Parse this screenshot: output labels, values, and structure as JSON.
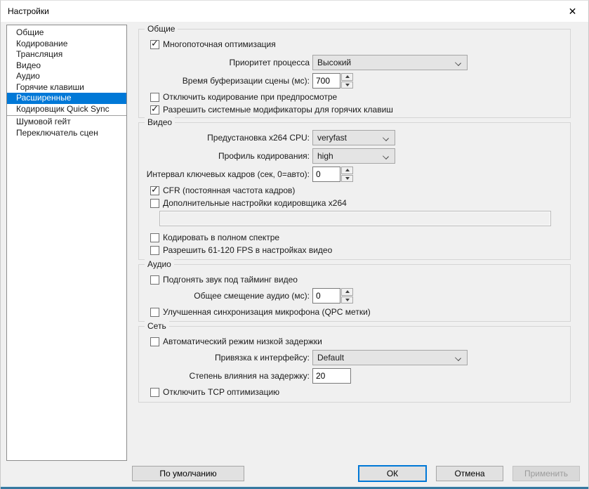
{
  "window": {
    "title": "Настройки"
  },
  "icons": {
    "close": "✕",
    "check": "✓"
  },
  "sidebar": {
    "items": [
      "Общие",
      "Кодирование",
      "Трансляция",
      "Видео",
      "Аудио",
      "Горячие клавиши",
      "Расширенные",
      "Кодировщик Quick Sync",
      "Шумовой гейт",
      "Переключатель сцен"
    ],
    "selected": "Расширенные"
  },
  "groups": {
    "general": {
      "title": "Общие",
      "multithread_checkbox": "Многопоточная оптимизация",
      "priority_label": "Приоритет процесса",
      "priority_value": "Высокий",
      "buffer_label": "Время буферизации сцены (мс):",
      "buffer_value": "700",
      "disable_preview_encoding_checkbox": "Отключить кодирование при предпросмотре",
      "allow_modifiers_checkbox": "Разрешить системные модификаторы для горячих клавиш"
    },
    "video": {
      "title": "Видео",
      "preset_label": "Предустановка x264 CPU:",
      "preset_value": "veryfast",
      "profile_label": "Профиль кодирования:",
      "profile_value": "high",
      "keyframe_label": "Интервал ключевых кадров (сек, 0=авто):",
      "keyframe_value": "0",
      "cfr_checkbox": "CFR (постоянная частота кадров)",
      "custom_x264_checkbox": "Дополнительные настройки кодировщика x264",
      "custom_x264_value": "",
      "full_range_checkbox": "Кодировать в полном спектре",
      "allow_fps_checkbox": "Разрешить 61-120 FPS в настройках видео"
    },
    "audio": {
      "title": "Аудио",
      "sync_checkbox": "Подгонять звук под тайминг видео",
      "offset_label": "Общее смещение аудио (мс):",
      "offset_value": "0",
      "mic_qpc_checkbox": "Улучшенная синхронизация микрофона (QPC метки)"
    },
    "network": {
      "title": "Сеть",
      "low_latency_checkbox": "Автоматический режим низкой задержки",
      "binding_label": "Привязка к интерфейсу:",
      "binding_value": "Default",
      "latency_factor_label": "Степень влияния на задержку:",
      "latency_factor_value": "20",
      "tcp_checkbox": "Отключить TCP оптимизацию"
    }
  },
  "footer": {
    "default_button": "По умолчанию",
    "ok_button": "ОК",
    "cancel_button": "Отмена",
    "apply_button": "Применить"
  },
  "colors": {
    "accent": "#0078d7",
    "selection": "#0078d7",
    "window_bottom_border": "#36789f",
    "dialog_background": "#f0f0f0"
  }
}
